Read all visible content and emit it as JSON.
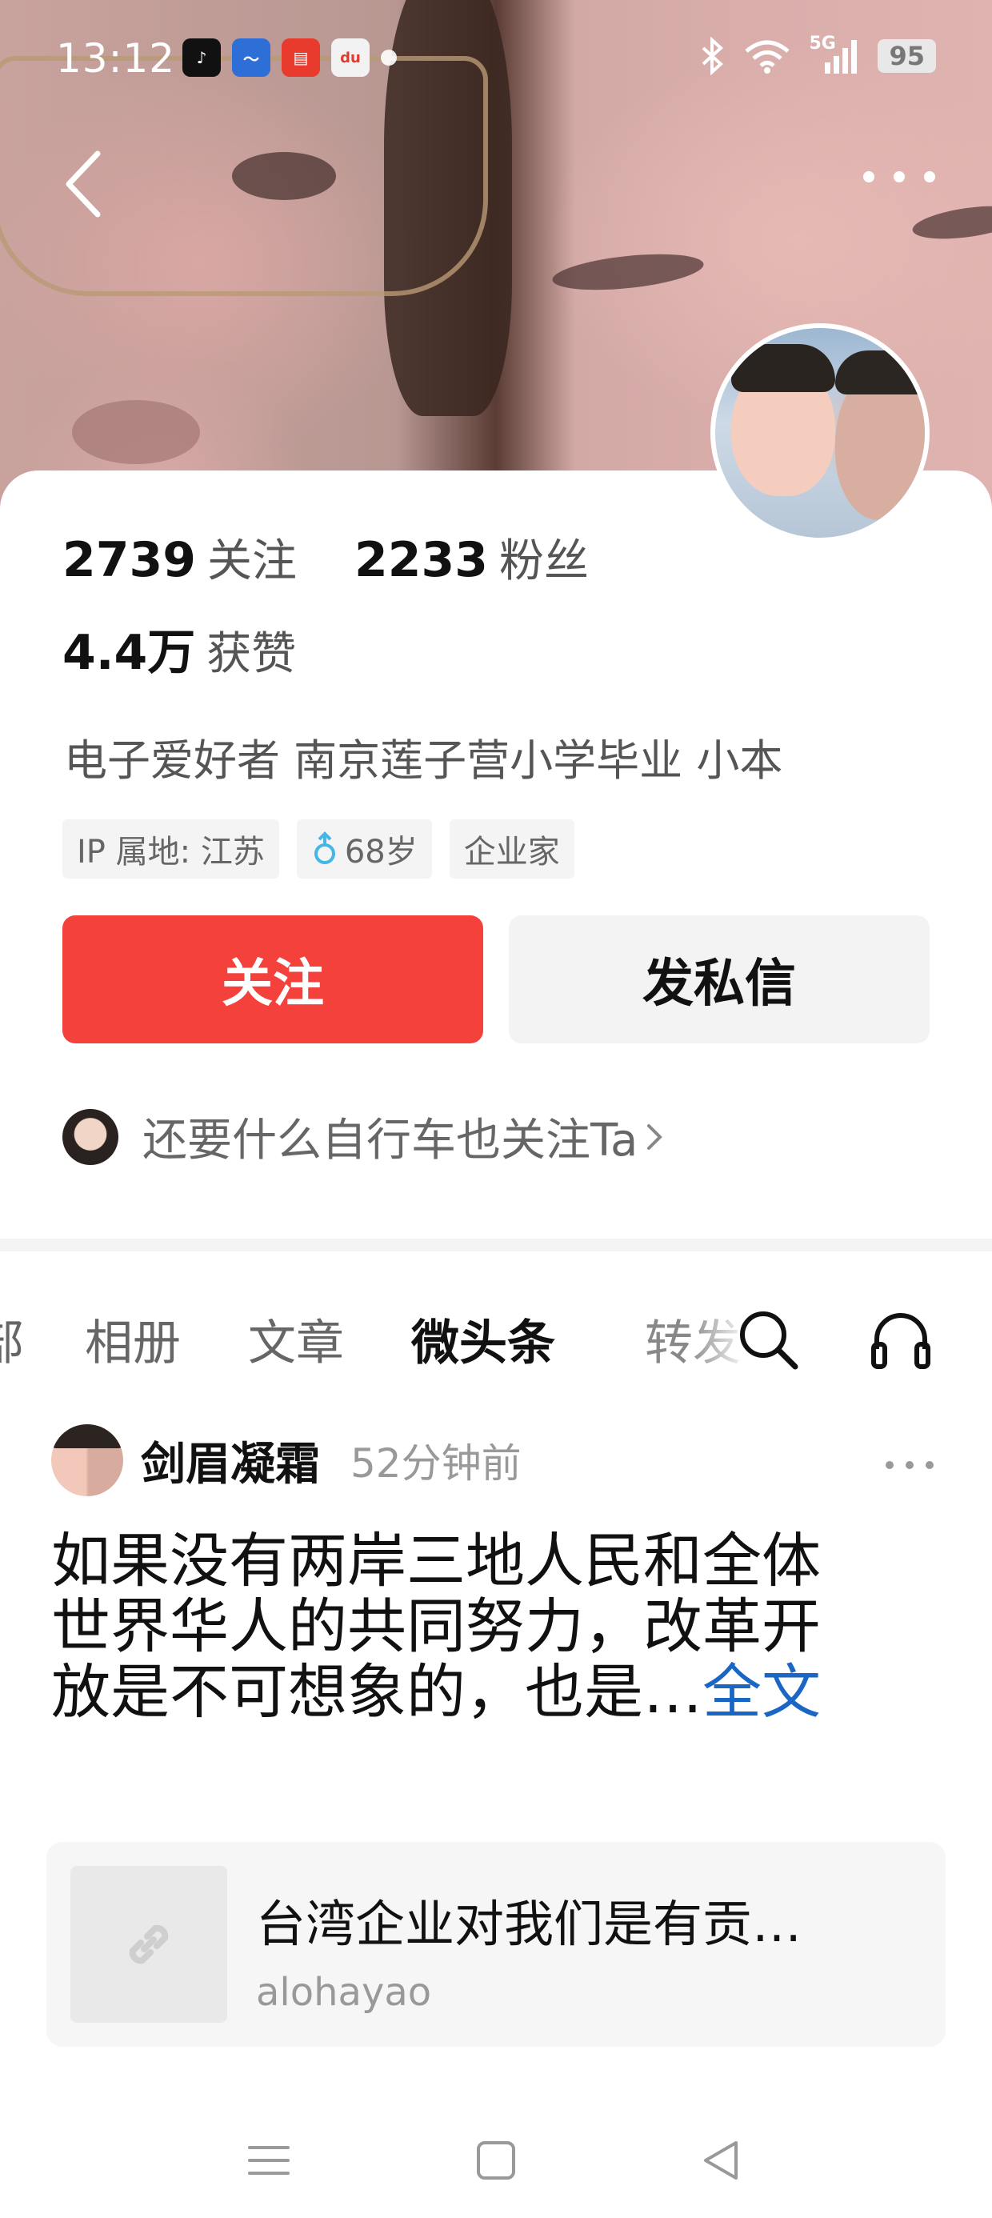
{
  "status_bar": {
    "time": "13:12",
    "network": "5G",
    "battery": "95",
    "icons": [
      "bluetooth-icon",
      "wifi-icon",
      "signal-icon",
      "battery-icon"
    ],
    "notification_apps": [
      {
        "name": "tiktok-app-icon",
        "color": "#111111",
        "glyph": "♪"
      },
      {
        "name": "stock-app-icon",
        "color": "#2d6fd6",
        "glyph": "〜"
      },
      {
        "name": "news-app-icon",
        "color": "#e83b2e",
        "glyph": "▤"
      },
      {
        "name": "map-app-icon",
        "color": "#f2f2f2",
        "glyph": "du"
      }
    ]
  },
  "nav": {
    "back_icon": "chevron-left-icon",
    "more_icon": "more-horizontal-icon"
  },
  "profile": {
    "following_count": "2739",
    "following_label": "关注",
    "followers_count": "2233",
    "followers_label": "粉丝",
    "likes_count": "4.4万",
    "likes_label": "获赞",
    "bio": "电子爱好者 南京莲子营小学毕业 小本",
    "tags": [
      {
        "label": "IP 属地: 江苏"
      },
      {
        "label": "68岁",
        "icon": "male-icon"
      },
      {
        "label": "企业家"
      }
    ],
    "follow_button": "关注",
    "message_button": "发私信",
    "recommendation": "还要什么自行车也关注Ta"
  },
  "tabs": [
    {
      "label": "部"
    },
    {
      "label": "相册"
    },
    {
      "label": "文章"
    },
    {
      "label": "微头条",
      "active": true
    },
    {
      "label": "转发"
    }
  ],
  "post": {
    "author": "剑眉凝霜",
    "time": "52分钟前",
    "text_lines": [
      "如果没有两岸三地人民和全体",
      "世界华人的共同努力，改革开",
      "放是不可想象的，也是…"
    ],
    "full_text_link": "全文",
    "link_card": {
      "title": "台湾企业对我们是有贡…",
      "source": "alohayao"
    }
  },
  "colors": {
    "follow_red": "#f5413b",
    "link_blue": "#1a66c5",
    "tag_bg": "#f4f4f4"
  }
}
